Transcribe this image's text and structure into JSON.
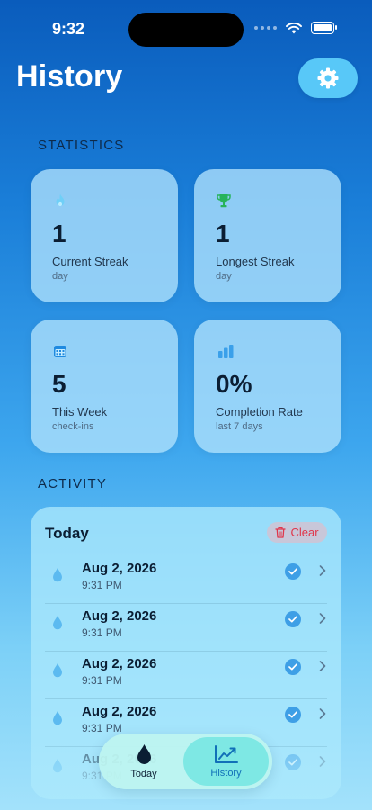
{
  "status_bar": {
    "time": "9:32"
  },
  "header": {
    "title": "History",
    "settings_icon": "gear-icon"
  },
  "stats": {
    "section_label": "STATISTICS",
    "cards": [
      {
        "icon": "flame-icon",
        "value": "1",
        "title": "Current Streak",
        "sub": "day",
        "icon_color": "#6fcff7"
      },
      {
        "icon": "trophy-icon",
        "value": "1",
        "title": "Longest Streak",
        "sub": "day",
        "icon_color": "#27b35a"
      },
      {
        "icon": "calendar-icon",
        "value": "5",
        "title": "This Week",
        "sub": "check-ins",
        "icon_color": "#1f8ae0"
      },
      {
        "icon": "bar-chart-icon",
        "value": "0%",
        "title": "Completion Rate",
        "sub": "last 7 days",
        "icon_color": "#3aa0ea"
      }
    ]
  },
  "activity": {
    "section_label": "ACTIVITY",
    "heading": "Today",
    "clear_label": "Clear",
    "entries": [
      {
        "date": "Aug 2, 2026",
        "time": "9:31 PM"
      },
      {
        "date": "Aug 2, 2026",
        "time": "9:31 PM"
      },
      {
        "date": "Aug 2, 2026",
        "time": "9:31 PM"
      },
      {
        "date": "Aug 2, 2026",
        "time": "9:31 PM"
      },
      {
        "date": "Aug 2, 2026",
        "time": "9:31 PM"
      }
    ]
  },
  "tabbar": {
    "tabs": [
      {
        "label": "Today",
        "icon": "water-drop-icon",
        "selected": false
      },
      {
        "label": "History",
        "icon": "trend-chart-icon",
        "selected": true
      }
    ]
  },
  "colors": {
    "accent": "#3e9fe6",
    "destructive": "#e0364b",
    "tab_selected": "#1170b8"
  }
}
